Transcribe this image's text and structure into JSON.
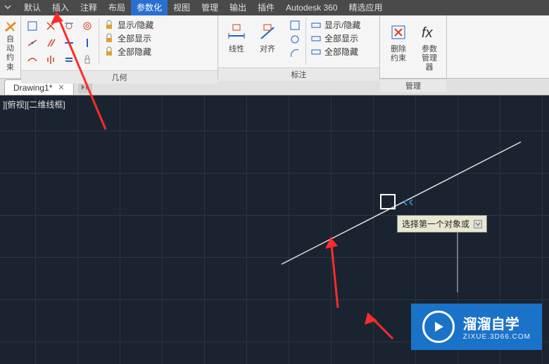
{
  "menubar": {
    "items": [
      "默认",
      "插入",
      "注释",
      "布局",
      "参数化",
      "视图",
      "管理",
      "输出",
      "插件",
      "Autodesk 360",
      "精选应用"
    ],
    "active_index": 4
  },
  "ribbon": {
    "left_partial": {
      "label_line1": "自动",
      "label_line2": "约束"
    },
    "geometry_panel": {
      "title": "几何",
      "show_hide": "显示/隐藏",
      "all_show": "全部显示",
      "all_hide": "全部隐藏",
      "constraints": [
        "coincident",
        "perpendicular",
        "tangent",
        "concentric",
        "collinear",
        "parallel",
        "horizontal",
        "vertical",
        "smooth",
        "symmetric",
        "equal",
        "fix"
      ]
    },
    "dim_panel": {
      "title": "标注",
      "linear": "线性",
      "align": "对齐",
      "show_hide": "显示/隐藏",
      "all_show": "全部显示",
      "all_hide": "全部隐藏"
    },
    "manage_panel": {
      "title": "管理",
      "delete": "删除\n约束",
      "param_mgr": "参数\n管理器"
    }
  },
  "tabs": {
    "current": "Drawing1*"
  },
  "canvas": {
    "viewport_label": "][俯视][二维线框]",
    "tooltip": "选择第一个对象或"
  },
  "watermark": {
    "title": "溜溜自学",
    "subtitle": "ZIXUE.3D66.COM"
  }
}
